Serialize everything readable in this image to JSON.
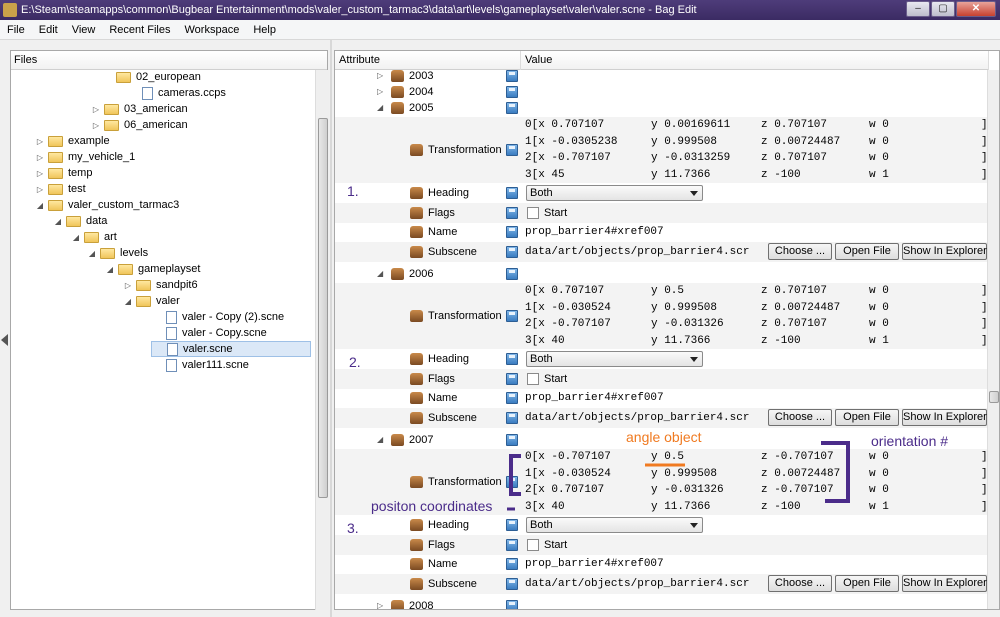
{
  "window": {
    "title": "E:\\Steam\\steamapps\\common\\Bugbear Entertainment\\mods\\valer_custom_tarmac3\\data\\art\\levels\\gameplayset\\valer\\valer.scne - Bag Edit",
    "min": "–",
    "max": "▢",
    "close": "✕"
  },
  "menu": [
    "File",
    "Edit",
    "View",
    "Recent Files",
    "Workspace",
    "Help"
  ],
  "files_panel": {
    "header": "Files",
    "items": [
      {
        "label": "02_european",
        "kind": "folder",
        "twist": ""
      },
      {
        "label": "cameras.ccps",
        "kind": "file",
        "twist": ""
      },
      {
        "label": "03_american",
        "kind": "folder",
        "twist": "▷"
      },
      {
        "label": "06_american",
        "kind": "folder",
        "twist": "▷"
      },
      {
        "label": "example",
        "kind": "folder",
        "twist": "▷"
      },
      {
        "label": "my_vehicle_1",
        "kind": "folder",
        "twist": "▷"
      },
      {
        "label": "temp",
        "kind": "folder",
        "twist": "▷"
      },
      {
        "label": "test",
        "kind": "folder",
        "twist": "▷"
      },
      {
        "label": "valer_custom_tarmac3",
        "kind": "folder",
        "twist": "◢"
      },
      {
        "label": "data",
        "kind": "folder",
        "twist": "◢"
      },
      {
        "label": "art",
        "kind": "folder",
        "twist": "◢"
      },
      {
        "label": "levels",
        "kind": "folder",
        "twist": "◢"
      },
      {
        "label": "gameplayset",
        "kind": "folder",
        "twist": "◢"
      },
      {
        "label": "sandpit6",
        "kind": "folder",
        "twist": "▷"
      },
      {
        "label": "valer",
        "kind": "folder",
        "twist": "◢"
      },
      {
        "label": "valer - Copy (2).scne",
        "kind": "file",
        "twist": ""
      },
      {
        "label": "valer - Copy.scne",
        "kind": "file",
        "twist": ""
      },
      {
        "label": "valer.scne",
        "kind": "file",
        "twist": "",
        "selected": true
      },
      {
        "label": "valer111.scne",
        "kind": "file",
        "twist": ""
      }
    ]
  },
  "attr_panel": {
    "col_attribute": "Attribute",
    "col_value": "Value",
    "nodes": [
      "2003",
      "2004",
      "2005",
      "2006",
      "2007",
      "2008"
    ],
    "labels": {
      "transformation": "Transformation",
      "heading": "Heading",
      "flags": "Flags",
      "name": "Name",
      "subscene": "Subscene",
      "start": "Start"
    },
    "buttons": {
      "choose": "Choose ...",
      "open_file": "Open File",
      "show_in_explorer": "Show In Explorer"
    },
    "entries": [
      {
        "node": "2005",
        "matrix": [
          [
            "0[x 0.707107",
            "y 0.00169611",
            "z 0.707107",
            "w 0",
            "]"
          ],
          [
            "1[x -0.0305238",
            "y 0.999508",
            "z 0.00724487",
            "w 0",
            "]"
          ],
          [
            "2[x -0.707107",
            "y -0.0313259",
            "z 0.707107",
            "w 0",
            "]"
          ],
          [
            "3[x 45",
            "y 11.7366",
            "z -100",
            "w 1",
            "]"
          ]
        ],
        "heading": "Both",
        "name": "prop_barrier4#xref007",
        "subscene": "data/art/objects/prop_barrier4.scr"
      },
      {
        "node": "2006",
        "matrix": [
          [
            "0[x 0.707107",
            "y 0.5",
            "z 0.707107",
            "w 0",
            "]"
          ],
          [
            "1[x -0.030524",
            "y 0.999508",
            "z 0.00724487",
            "w 0",
            "]"
          ],
          [
            "2[x -0.707107",
            "y -0.031326",
            "z 0.707107",
            "w 0",
            "]"
          ],
          [
            "3[x 40",
            "y 11.7366",
            "z -100",
            "w 1",
            "]"
          ]
        ],
        "heading": "Both",
        "name": "prop_barrier4#xref007",
        "subscene": "data/art/objects/prop_barrier4.scr"
      },
      {
        "node": "2007",
        "matrix": [
          [
            "0[x -0.707107",
            "y 0.5",
            "z -0.707107",
            "w 0",
            "]"
          ],
          [
            "1[x -0.030524",
            "y 0.999508",
            "z 0.00724487",
            "w 0",
            "]"
          ],
          [
            "2[x 0.707107",
            "y -0.031326",
            "z -0.707107",
            "w 0",
            "]"
          ],
          [
            "3[x 40",
            "y 11.7366",
            "z -100",
            "w 1",
            "]"
          ]
        ],
        "heading": "Both",
        "name": "prop_barrier4#xref007",
        "subscene": "data/art/objects/prop_barrier4.scr"
      }
    ]
  },
  "annotations": {
    "n1": "1.",
    "n2": "2.",
    "n3": "3.",
    "angle_object": "angle object",
    "orientation": "orientation #",
    "position": "positon coordinates"
  },
  "colors": {
    "annotation_purple": "#4b2c8a",
    "annotation_orange": "#f07a20"
  }
}
